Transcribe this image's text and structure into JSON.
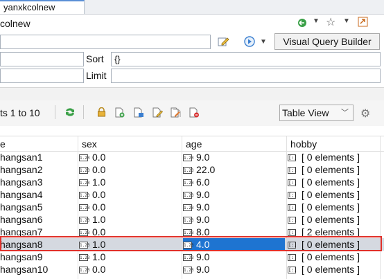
{
  "tab": {
    "label": "yanxkcolnew"
  },
  "editor": {
    "title": "colnew"
  },
  "query": {
    "sort_label": "Sort",
    "sort_value": "{}",
    "limit_label": "Limit",
    "limit_value": "",
    "filter_value": "",
    "projection_value": "",
    "vqb_label": "Visual Query Builder"
  },
  "results": {
    "range_text": "ts 1 to 10",
    "view_select": "Table View"
  },
  "table": {
    "columns": [
      "e",
      "sex",
      "age",
      "hobby"
    ],
    "rows": [
      {
        "name": "hangsan1",
        "sex": "0.0",
        "age": "9.0",
        "hobby": "[ 0 elements ]"
      },
      {
        "name": "hangsan2",
        "sex": "0.0",
        "age": "22.0",
        "hobby": "[ 0 elements ]"
      },
      {
        "name": "hangsan3",
        "sex": "1.0",
        "age": "6.0",
        "hobby": "[ 0 elements ]"
      },
      {
        "name": "hangsan4",
        "sex": "0.0",
        "age": "9.0",
        "hobby": "[ 0 elements ]"
      },
      {
        "name": "hangsan5",
        "sex": "0.0",
        "age": "9.0",
        "hobby": "[ 0 elements ]"
      },
      {
        "name": "hangsan6",
        "sex": "1.0",
        "age": "9.0",
        "hobby": "[ 0 elements ]"
      },
      {
        "name": "hangsan7",
        "sex": "0.0",
        "age": "8.0",
        "hobby": "[ 2 elements ]"
      },
      {
        "name": "hangsan8",
        "sex": "1.0",
        "age": "4.0",
        "hobby": "[ 0 elements ]"
      },
      {
        "name": "hangsan9",
        "sex": "1.0",
        "age": "9.0",
        "hobby": "[ 0 elements ]"
      },
      {
        "name": "hangsan10",
        "sex": "0.0",
        "age": "9.0",
        "hobby": "[ 0 elements ]"
      }
    ],
    "selected_row": 8,
    "selected_column": "age"
  },
  "icons": {
    "number_glyph": "1.23",
    "array_glyph": "[:]"
  },
  "colors": {
    "selection": "#1e74d1",
    "row_highlight": "#d5d9e0",
    "annotation_box": "#e0302a"
  }
}
